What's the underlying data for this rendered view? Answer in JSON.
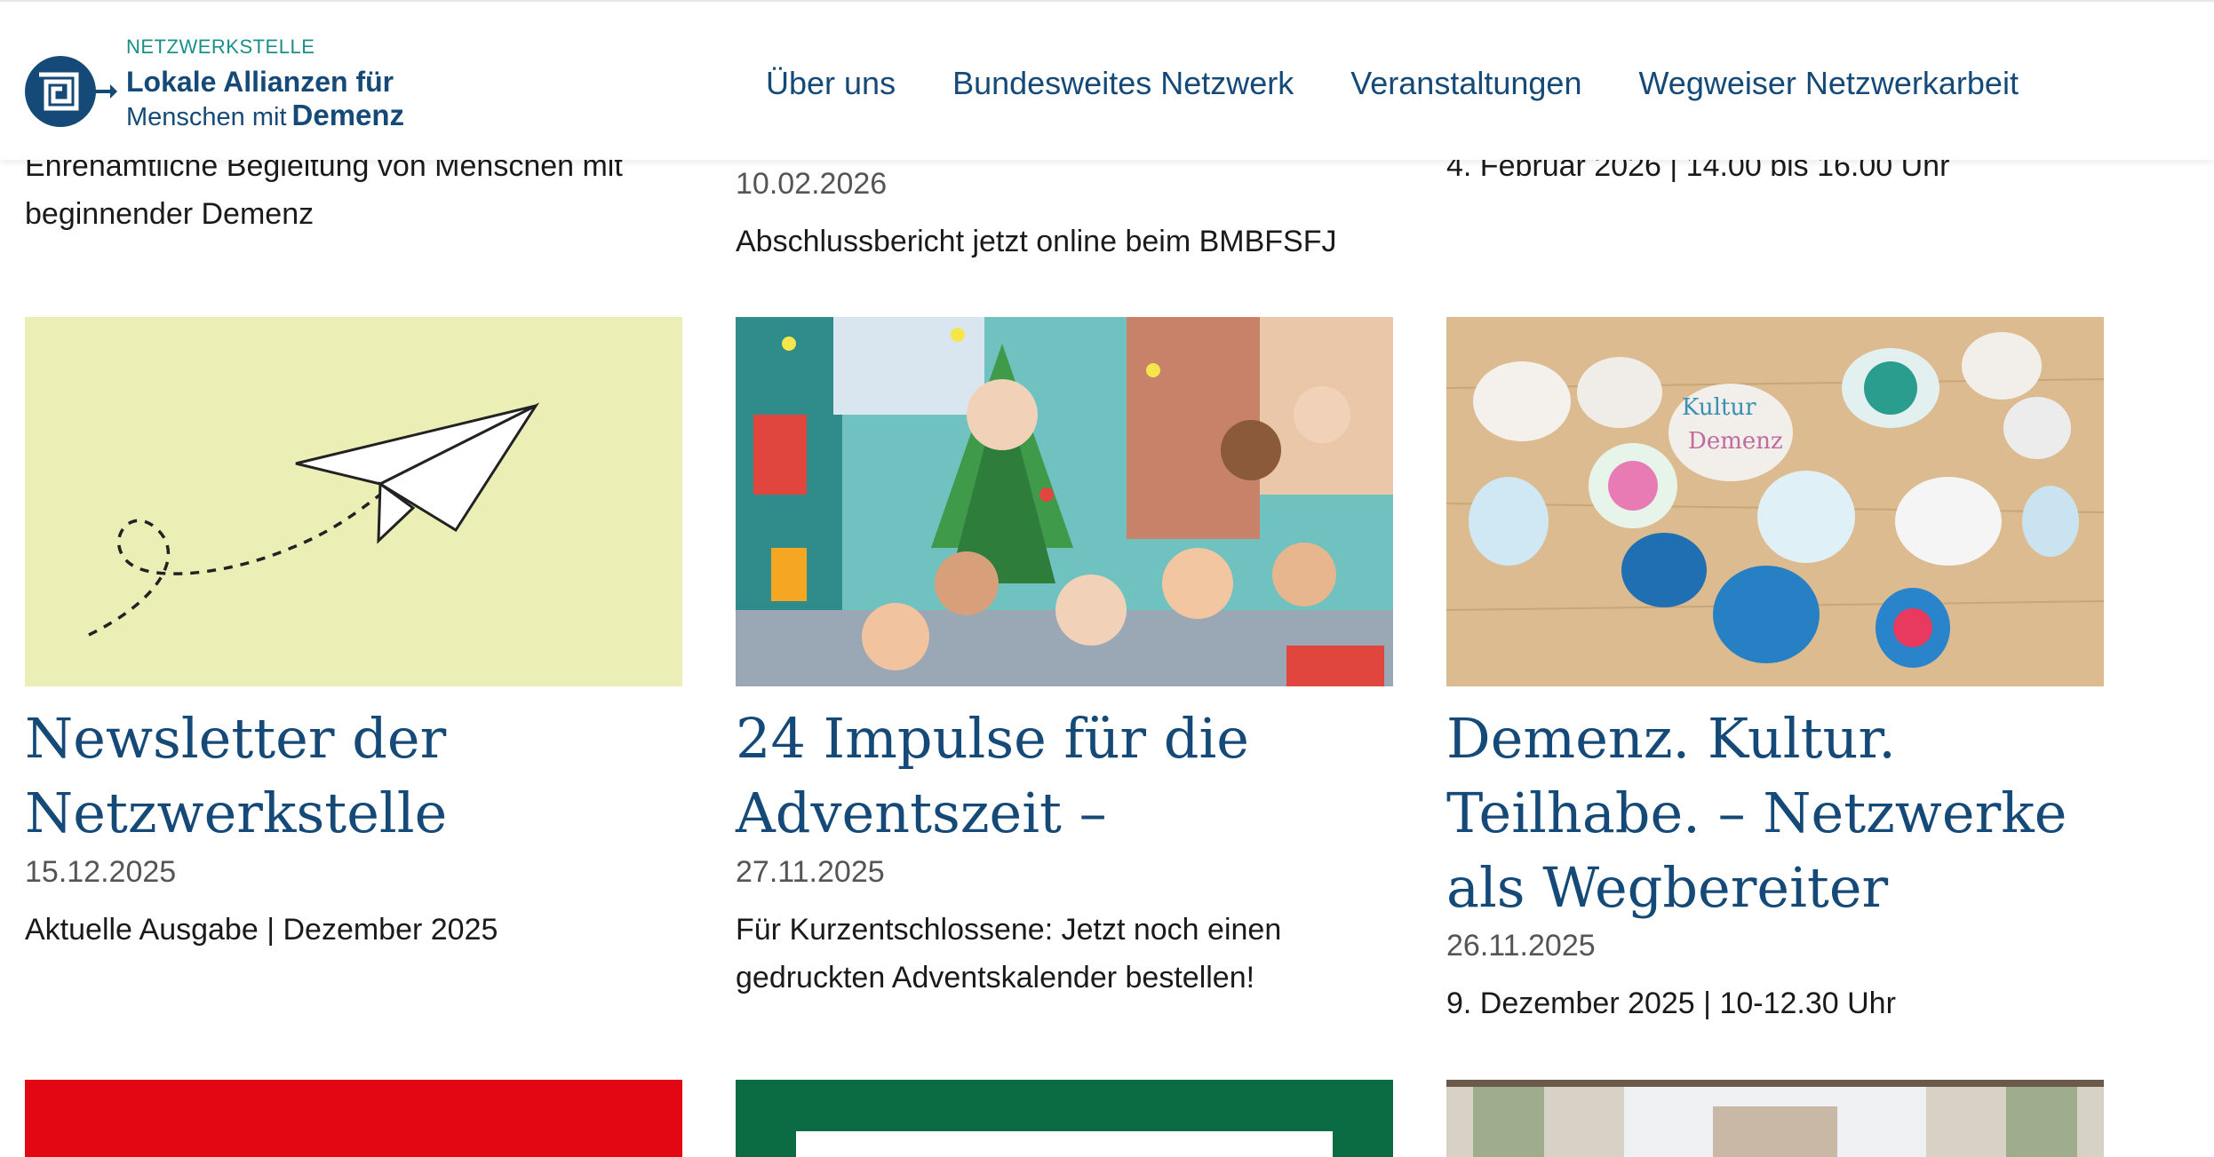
{
  "brand": {
    "kicker": "NETZWERKSTELLE",
    "line1": "Lokale Allianzen für",
    "line2_prefix": "Menschen mit",
    "line2_bold": "Demenz",
    "colors": {
      "primary": "#154a78",
      "teal": "#1a8f8a"
    }
  },
  "nav": {
    "items": [
      {
        "label": "Über uns"
      },
      {
        "label": "Bundesweites Netzwerk"
      },
      {
        "label": "Veranstaltungen"
      },
      {
        "label": "Wegweiser Netzwerkarbeit"
      }
    ]
  },
  "previous_row": {
    "col1_text": "Ehrenamtliche Begleitung von Menschen mit beginnender Demenz",
    "col2_date": "10.02.2026",
    "col2_text": "Abschlussbericht jetzt online beim BMBFSFJ",
    "col3_text": "4. Februar 2026 | 14.00 bis 16.00 Uhr"
  },
  "cards": [
    {
      "title": "Newsletter der Netzwerkstelle",
      "date": "15.12.2025",
      "text": "Aktuelle Ausgabe | Dezember 2025",
      "image": "paper-plane-illustration"
    },
    {
      "title": "24 Impulse für die Adventszeit –",
      "date": "27.11.2025",
      "text": "Für Kurzentschlossene: Jetzt noch einen gedruckten Adventskalender bestellen!",
      "image": "advent-calendar-illustration"
    },
    {
      "title": "Demenz. Kultur. Teilhabe. – Netzwerke als Wegbereiter",
      "date": "26.11.2025",
      "text": "9. Dezember 2025 | 10-12.30 Uhr",
      "image": "painted-stones-photo",
      "stone_text_1": "Kultur",
      "stone_text_2": "Demenz"
    }
  ],
  "bottom_row": [
    {
      "image": "red-banner",
      "color": "#e30613"
    },
    {
      "image": "green-frame",
      "color": "#0b6b43"
    },
    {
      "image": "room-photo"
    }
  ]
}
